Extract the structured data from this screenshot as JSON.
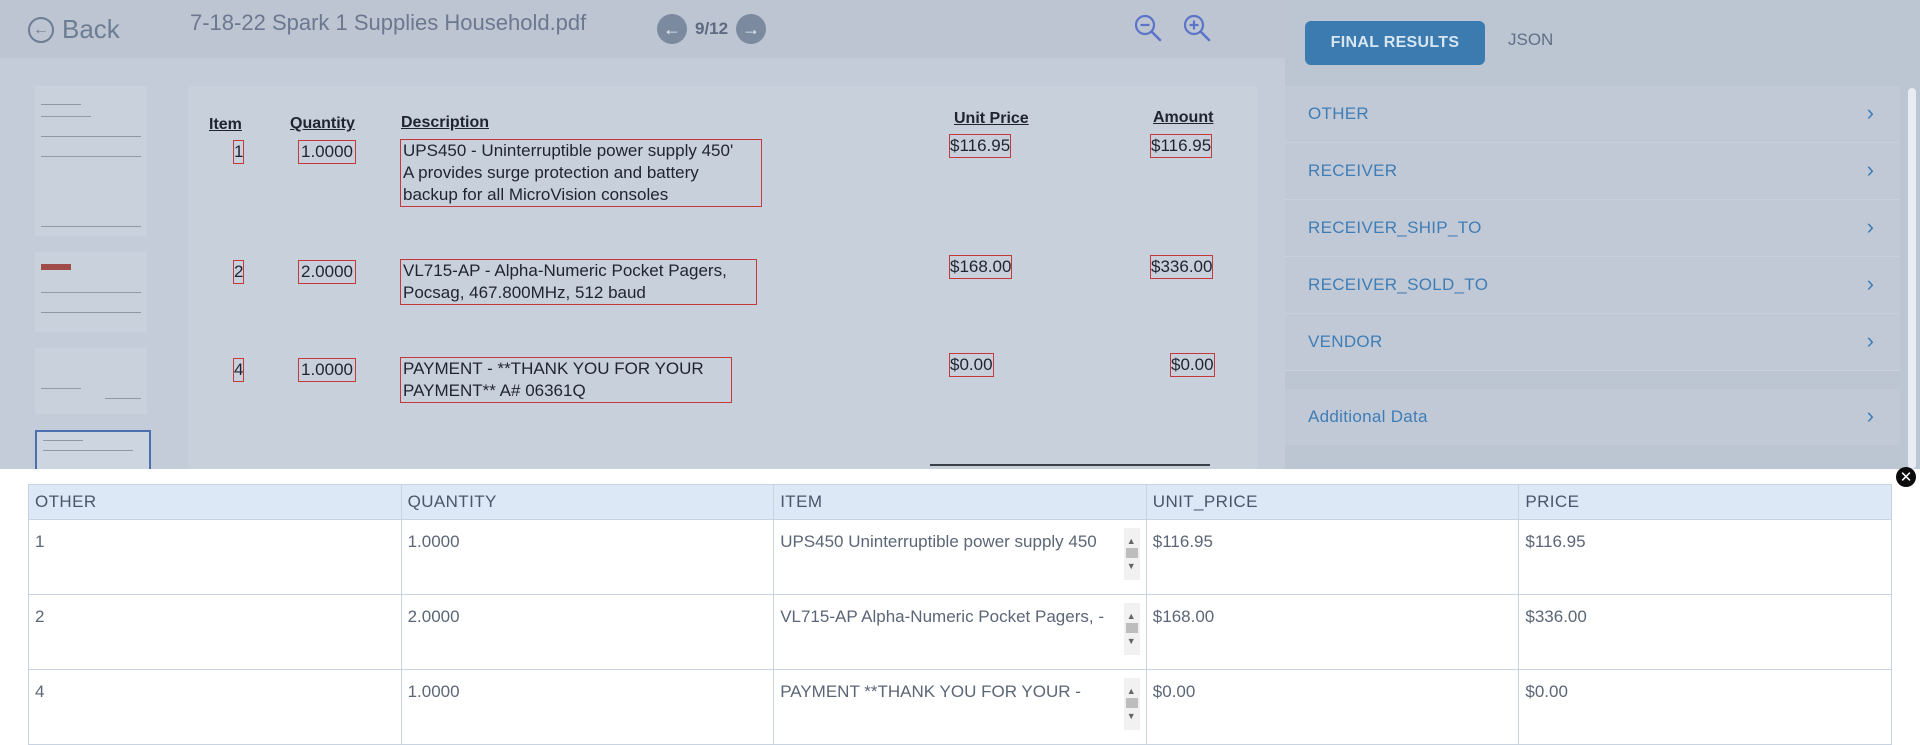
{
  "header": {
    "back_label": "Back",
    "doc_title": "7-18-22 Spark 1 Supplies Household.pdf",
    "page_indicator": "9/12"
  },
  "icons": {
    "back": "back-arrow-circle-icon",
    "prev": "arrow-left-circle-icon",
    "next": "arrow-right-circle-icon",
    "zoom_out": "zoom-out-icon",
    "zoom_in": "zoom-in-icon",
    "close": "close-icon"
  },
  "document": {
    "headers": {
      "item": "Item",
      "quantity": "Quantity",
      "description": "Description",
      "unit_price": "Unit Price",
      "amount": "Amount"
    },
    "rows": [
      {
        "item": "1",
        "quantity": "1.0000",
        "desc_lines": [
          "UPS450 - Uninterruptible power supply 450'",
          "A provides surge protection and battery",
          "backup for all MicroVision consoles"
        ],
        "unit_price": "$116.95",
        "amount": "$116.95"
      },
      {
        "item": "2",
        "quantity": "2.0000",
        "desc_lines": [
          "VL715-AP - Alpha-Numeric Pocket Pagers,",
          "Pocsag, 467.800MHz, 512 baud"
        ],
        "unit_price": "$168.00",
        "amount": "$336.00"
      },
      {
        "item": "4",
        "quantity": "1.0000",
        "desc_lines": [
          "PAYMENT - **THANK YOU FOR YOUR",
          "PAYMENT** A# 06361Q"
        ],
        "unit_price": "$0.00",
        "amount": "$0.00"
      }
    ]
  },
  "panel": {
    "tab_final": "FINAL RESULTS",
    "tab_json": "JSON",
    "sections": [
      "OTHER",
      "RECEIVER",
      "RECEIVER_SHIP_TO",
      "RECEIVER_SOLD_TO",
      "VENDOR"
    ],
    "additional": "Additional Data"
  },
  "table": {
    "columns": [
      "OTHER",
      "QUANTITY",
      "ITEM",
      "UNIT_PRICE",
      "PRICE"
    ],
    "rows": [
      {
        "other": "1",
        "quantity": "1.0000",
        "item": "UPS450 Uninterruptible power supply 450",
        "unit_price": "$116.95",
        "price": "$116.95"
      },
      {
        "other": "2",
        "quantity": "2.0000",
        "item": "VL715-AP Alpha-Numeric Pocket Pagers, -",
        "unit_price": "$168.00",
        "price": "$336.00"
      },
      {
        "other": "4",
        "quantity": "1.0000",
        "item": "PAYMENT **THANK YOU FOR YOUR -",
        "unit_price": "$0.00",
        "price": "$0.00"
      }
    ]
  }
}
